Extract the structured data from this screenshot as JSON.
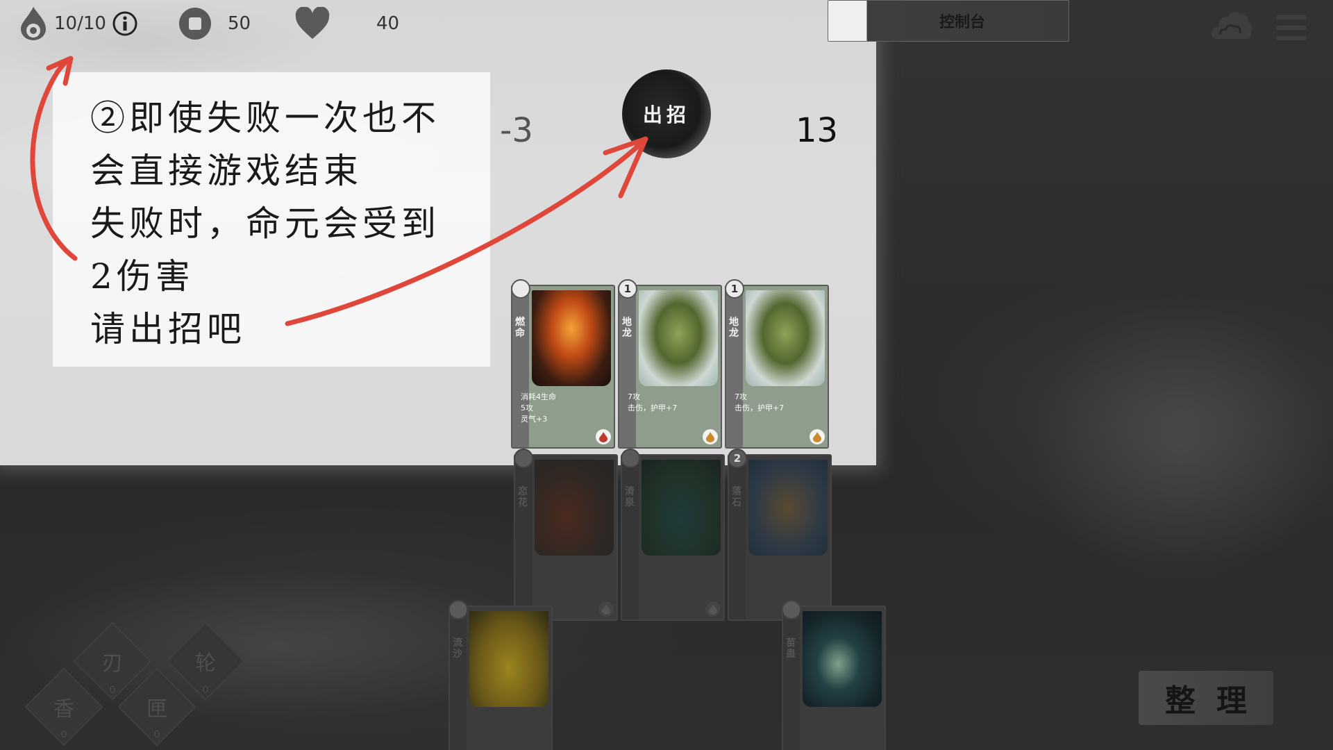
{
  "stats": {
    "lives": "10/10",
    "stop_value": "50",
    "heart_value": "40"
  },
  "console": {
    "label": "控制台"
  },
  "tutorial": {
    "lines": [
      "②即使失败一次也不",
      "会直接游戏结束",
      "失败时，命元会受到",
      "2伤害",
      "请出招吧"
    ]
  },
  "battle": {
    "left_value": "-3",
    "right_value": "13",
    "play_label": "出招"
  },
  "cards_row1": [
    {
      "name": "燃命",
      "cost": "",
      "desc": [
        "消耗4生命",
        "5攻",
        "灵气+3"
      ],
      "art": "fire"
    },
    {
      "name": "地龙",
      "cost": "1",
      "desc": [
        "7攻",
        "击伤，护甲+7"
      ],
      "art": "dragon"
    },
    {
      "name": "地龙",
      "cost": "1",
      "desc": [
        "7攻",
        "击伤，护甲+7"
      ],
      "art": "dragon"
    }
  ],
  "cards_row2": [
    {
      "name": "恋花",
      "cost": "",
      "art": "flower"
    },
    {
      "name": "清泉",
      "cost": "",
      "art": "forest"
    },
    {
      "name": "落石",
      "cost": "2",
      "art": "rock"
    }
  ],
  "cards_row3": [
    {
      "name": "流沙",
      "cost": "",
      "art": "yellow"
    },
    {
      "name": "苗蛊",
      "cost": "",
      "art": "space"
    }
  ],
  "skills": [
    {
      "label": "刃",
      "count": "0"
    },
    {
      "label": "轮",
      "count": "0"
    },
    {
      "label": "香",
      "count": "0"
    },
    {
      "label": "匣",
      "count": "0"
    }
  ],
  "sort_button": {
    "label": "整理"
  },
  "colors": {
    "arrow": "#e0473b",
    "card_green": "#8f9e8c",
    "panel": "#f8f8f8"
  }
}
